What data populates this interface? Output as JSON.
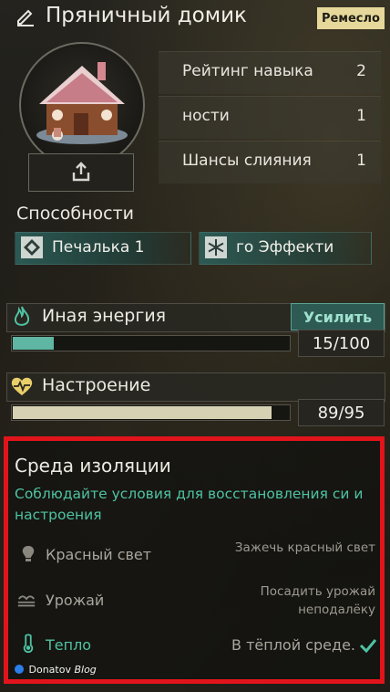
{
  "header": {
    "title": "Пряничный домик",
    "badge": "Ремесло"
  },
  "stats": [
    {
      "label": "Рейтинг навыка",
      "value": "2"
    },
    {
      "label": "ности",
      "value": "1"
    },
    {
      "label": "Шансы слияния",
      "value": "1"
    }
  ],
  "abilities": {
    "title": "Способности",
    "items": [
      {
        "label": "Печалька 1",
        "icon": "diamond-icon"
      },
      {
        "label": "го   Эффекти",
        "icon": "snowflake-icon"
      }
    ]
  },
  "energy": {
    "label": "Иная энергия",
    "button": "Усилить",
    "value": "15/100",
    "current": 15,
    "max": 100,
    "icon": "flame-icon",
    "color": "#5fb6a2"
  },
  "mood": {
    "label": "Настроение",
    "value": "89/95",
    "current": 89,
    "max": 95,
    "icon": "heart-pulse-icon",
    "color": "#d6d1b3"
  },
  "isolation": {
    "title": "Среда изоляции",
    "hint": "Соблюдайте условия для восстановления си и настроения",
    "conditions": [
      {
        "label": "Красный свет",
        "desc": "Зажечь красный свет",
        "active": false,
        "icon": "bulb-icon"
      },
      {
        "label": "Урожай",
        "desc": "Посадить урожай неподалёку",
        "active": false,
        "icon": "crop-icon"
      },
      {
        "label": "Тепло",
        "desc": "В тёплой среде.",
        "active": true,
        "icon": "thermometer-icon"
      }
    ]
  },
  "watermark": {
    "brand": "Donatov",
    "suffix": "Blog"
  },
  "colors": {
    "accent": "#4fc2a2",
    "badge": "#e6d89a",
    "highlight": "#e2141b"
  }
}
